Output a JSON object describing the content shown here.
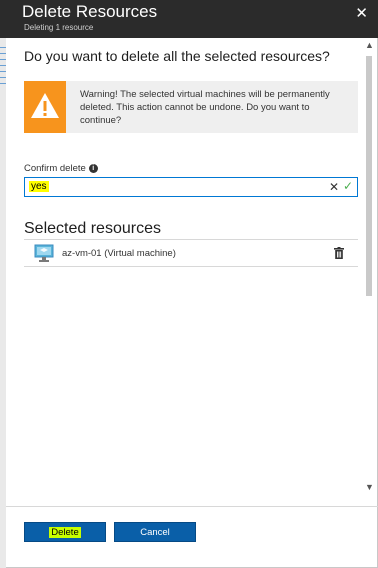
{
  "header": {
    "title": "Delete Resources",
    "subtitle": "Deleting 1 resource",
    "close_glyph": "✕"
  },
  "question": "Do you want to delete all the selected resources?",
  "warning": {
    "icon": "warning-triangle-icon",
    "text": "Warning! The selected virtual machines will be permanently deleted. This action cannot be undone. Do you want to continue?",
    "color": "#f7941d"
  },
  "confirm": {
    "label": "Confirm delete",
    "value": "yes",
    "clear_glyph": "✕",
    "check_glyph": "✓"
  },
  "selected": {
    "title": "Selected resources",
    "items": [
      {
        "name": "az-vm-01  (Virtual machine)",
        "icon": "virtual-machine-icon"
      }
    ]
  },
  "buttons": {
    "delete_label": "Delete",
    "cancel_label": "Cancel",
    "color": "#0a5fa8"
  }
}
